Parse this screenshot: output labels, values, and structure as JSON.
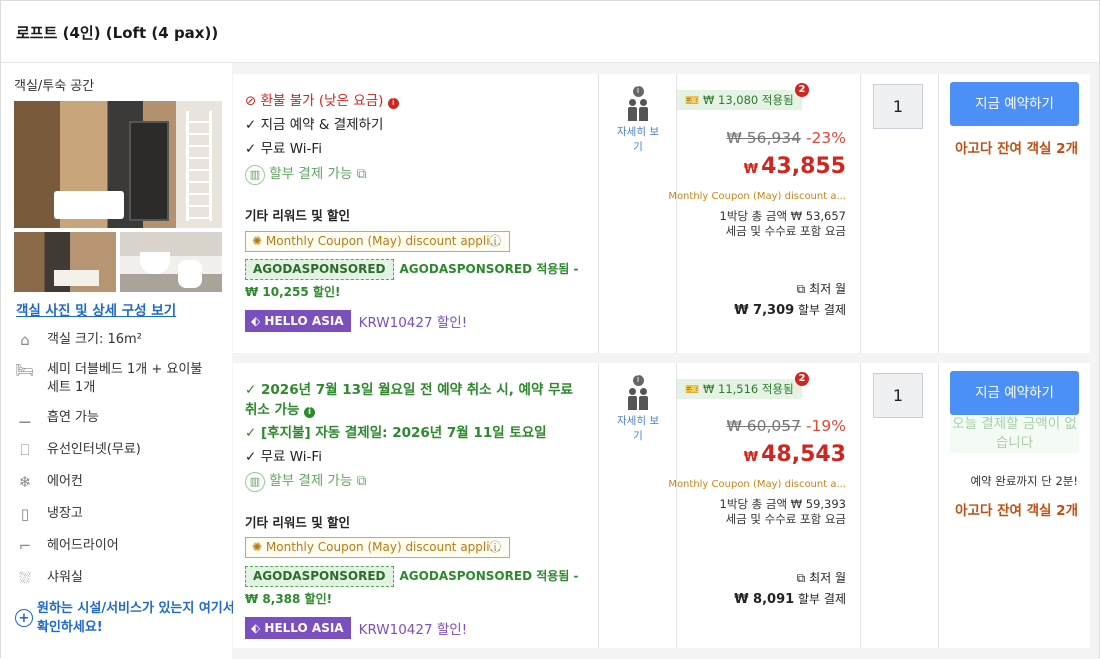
{
  "header": {
    "title": "로프트 (4인) (Loft (4 pax))"
  },
  "sidebar": {
    "section_title": "객실/투숙 공간",
    "room_link": "객실 사진 및 상세 구성 보기",
    "features": [
      {
        "icon": "house-icon",
        "label": "객실 크기: 16m²"
      },
      {
        "icon": "bed-icon",
        "label": "세미 더블베드 1개 + 요이불 세트 1개"
      },
      {
        "icon": "smoking-icon",
        "label": "흡연 가능"
      },
      {
        "icon": "ethernet-icon",
        "label": "유선인터넷(무료)"
      },
      {
        "icon": "snowflake-icon",
        "label": "에어컨"
      },
      {
        "icon": "fridge-icon",
        "label": "냉장고"
      },
      {
        "icon": "hairdryer-icon",
        "label": "헤어드라이어"
      },
      {
        "icon": "shower-icon",
        "label": "샤워실"
      }
    ],
    "more_link": "원하는 시설/서비스가 있는지 여기서 확인하세요!"
  },
  "offers": [
    {
      "benefits": [
        "환불 불가 (낮은 요금)",
        "지금 예약 & 결제하기",
        "무료 Wi-Fi"
      ],
      "installment": "할부 결제 가능",
      "other_title": "기타 리워드 및 할인",
      "coupon": "Monthly Coupon (May) discount appli...",
      "sponsored_tag": "AGODASPONSORED",
      "sponsored_text": "AGODASPONSORED 적용됨 - ₩ 10,255 할인!",
      "hello_tag": "HELLO ASIA",
      "hello_text": "KRW10427 할인!",
      "occupancy_link": "자세히 보기",
      "applied": "₩ 13,080 적용됨",
      "badge": "2",
      "original_price": "₩ 56,934",
      "discount_pct": "-23%",
      "currency": "₩",
      "price": "43,855",
      "monthly_coupon": "Monthly Coupon (May) discount a...",
      "total_line1": "1박당 총 금액 ₩ 53,657",
      "total_line2": "세금 및 수수료 포함 요금",
      "min_month": "최저 월",
      "installment_price": "₩ 7,309",
      "installment_suffix": "할부 결제",
      "quantity": "1",
      "book_label": "지금 예약하기",
      "rooms_left": "아고다 잔여 객실 2개"
    },
    {
      "benefits": [
        "2026년 7월 13일 월요일 전 예약 취소 시, 예약 무료 취소 가능",
        "[후지불] 자동 결제일: 2026년 7월 11일 토요일",
        "무료 Wi-Fi"
      ],
      "installment": "할부 결제 가능",
      "other_title": "기타 리워드 및 할인",
      "coupon": "Monthly Coupon (May) discount appli...",
      "sponsored_tag": "AGODASPONSORED",
      "sponsored_text": "AGODASPONSORED 적용됨 - ₩ 8,388 할인!",
      "hello_tag": "HELLO ASIA",
      "hello_text": "KRW10427 할인!",
      "occupancy_link": "자세히 보기",
      "applied": "₩ 11,516 적용됨",
      "badge": "2",
      "original_price": "₩ 60,057",
      "discount_pct": "-19%",
      "currency": "₩",
      "price": "48,543",
      "monthly_coupon": "Monthly Coupon (May) discount a...",
      "total_line1": "1박당 총 금액 ₩ 59,393",
      "total_line2": "세금 및 수수료 포함 요금",
      "min_month": "최저 월",
      "installment_price": "₩ 8,091",
      "installment_suffix": "할부 결제",
      "quantity": "1",
      "book_label": "지금 예약하기",
      "no_pay_today": "오늘 결제할 금액이 없습니다",
      "deadline": "예약 완료까지 단 2분!",
      "rooms_left": "아고다 잔여 객실 2개"
    }
  ],
  "colors": {
    "accent": "#4c8ff6",
    "price_red": "#d1251f",
    "green": "#2c8a2c",
    "purple": "#7b4fbd"
  }
}
